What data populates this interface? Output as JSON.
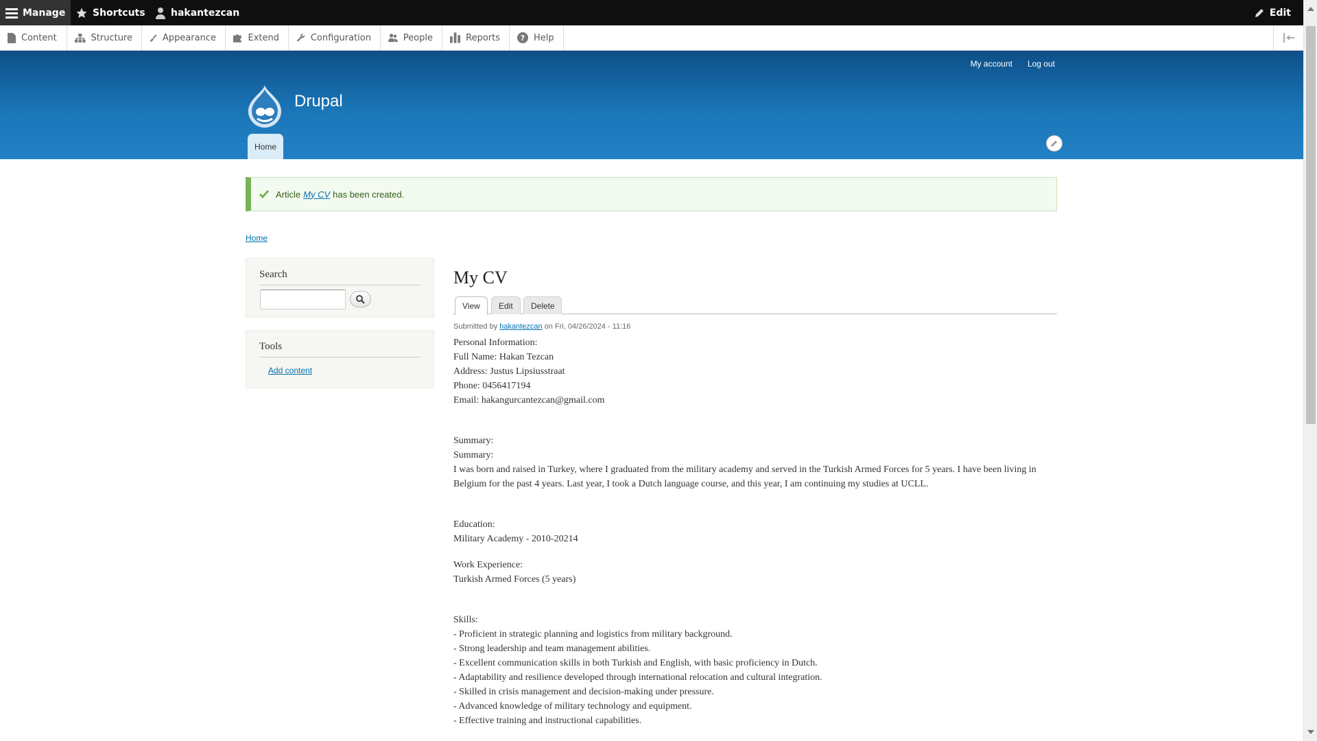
{
  "toolbar": {
    "manage": "Manage",
    "shortcuts": "Shortcuts",
    "user": "hakantezcan",
    "edit": "Edit"
  },
  "tray": {
    "items": [
      "Content",
      "Structure",
      "Appearance",
      "Extend",
      "Configuration",
      "People",
      "Reports",
      "Help"
    ]
  },
  "header": {
    "my_account": "My account",
    "log_out": "Log out",
    "site_name": "Drupal",
    "primary_tab": "Home"
  },
  "status": {
    "prefix": "Article",
    "link": "My CV",
    "suffix": "has been created."
  },
  "breadcrumb": {
    "home": "Home"
  },
  "sidebar": {
    "search_title": "Search",
    "tools_title": "Tools",
    "add_content": "Add content"
  },
  "node": {
    "title": "My CV",
    "tabs": {
      "view": "View",
      "edit": "Edit",
      "delete": "Delete"
    },
    "submitted_prefix": "Submitted by",
    "author": "hakantezcan",
    "submitted_suffix": "on Fri, 04/26/2024 - 11:16"
  },
  "body": {
    "personal_heading": "Personal Information:",
    "full_name": "Full Name: Hakan Tezcan",
    "address": "Address: Justus Lipsiusstraat",
    "phone": "Phone: 0456417194",
    "email": "Email: hakangurcantezcan@gmail.com",
    "summary_heading_1": "Summary:",
    "summary_heading_2": "Summary:",
    "summary_text": "I was born and raised in Turkey, where I graduated from the military academy and served in the Turkish Armed Forces for 5 years. I have been living in Belgium for the past 4 years. Last year, I took a Dutch language course, and this year, I am continuing my studies at UCLL.",
    "education_heading": "Education:",
    "education_text": "Military Academy - 2010-20214",
    "work_heading": "Work Experience:",
    "work_text": "Turkish Armed Forces (5 years)",
    "skills_heading": "Skills:",
    "skills": [
      "- Proficient in strategic planning and logistics from military background.",
      "- Strong leadership and team management abilities.",
      "- Excellent communication skills in both Turkish and English, with basic proficiency in Dutch.",
      "- Adaptability and resilience developed through international relocation and cultural integration.",
      "- Skilled in crisis management and decision-making under pressure.",
      "- Advanced knowledge of military technology and equipment.",
      "- Effective training and instructional capabilities."
    ]
  },
  "colors": {
    "toolbar_bg": "#0f0f0f",
    "header_top": "#0e4f88",
    "header_bottom": "#2280c5",
    "link": "#0071b3",
    "status_border": "#77b259"
  }
}
